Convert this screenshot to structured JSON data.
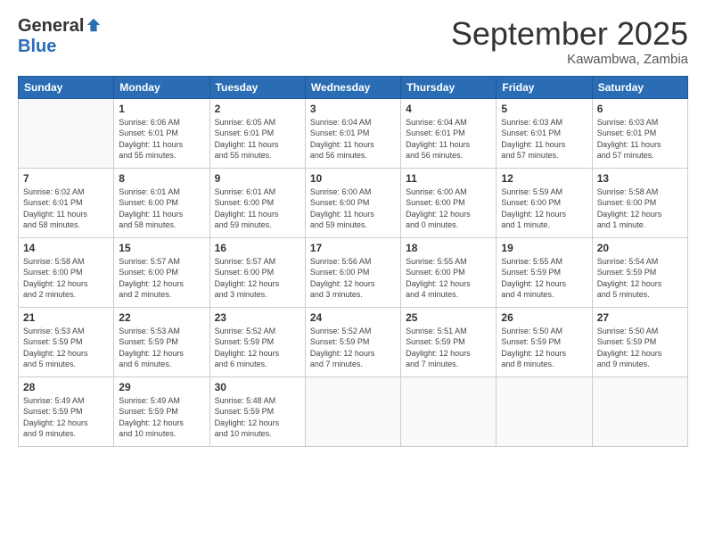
{
  "logo": {
    "general": "General",
    "blue": "Blue"
  },
  "title": "September 2025",
  "subtitle": "Kawambwa, Zambia",
  "weekdays": [
    "Sunday",
    "Monday",
    "Tuesday",
    "Wednesday",
    "Thursday",
    "Friday",
    "Saturday"
  ],
  "weeks": [
    [
      {
        "day": "",
        "info": ""
      },
      {
        "day": "1",
        "info": "Sunrise: 6:06 AM\nSunset: 6:01 PM\nDaylight: 11 hours\nand 55 minutes."
      },
      {
        "day": "2",
        "info": "Sunrise: 6:05 AM\nSunset: 6:01 PM\nDaylight: 11 hours\nand 55 minutes."
      },
      {
        "day": "3",
        "info": "Sunrise: 6:04 AM\nSunset: 6:01 PM\nDaylight: 11 hours\nand 56 minutes."
      },
      {
        "day": "4",
        "info": "Sunrise: 6:04 AM\nSunset: 6:01 PM\nDaylight: 11 hours\nand 56 minutes."
      },
      {
        "day": "5",
        "info": "Sunrise: 6:03 AM\nSunset: 6:01 PM\nDaylight: 11 hours\nand 57 minutes."
      },
      {
        "day": "6",
        "info": "Sunrise: 6:03 AM\nSunset: 6:01 PM\nDaylight: 11 hours\nand 57 minutes."
      }
    ],
    [
      {
        "day": "7",
        "info": "Sunrise: 6:02 AM\nSunset: 6:01 PM\nDaylight: 11 hours\nand 58 minutes."
      },
      {
        "day": "8",
        "info": "Sunrise: 6:01 AM\nSunset: 6:00 PM\nDaylight: 11 hours\nand 58 minutes."
      },
      {
        "day": "9",
        "info": "Sunrise: 6:01 AM\nSunset: 6:00 PM\nDaylight: 11 hours\nand 59 minutes."
      },
      {
        "day": "10",
        "info": "Sunrise: 6:00 AM\nSunset: 6:00 PM\nDaylight: 11 hours\nand 59 minutes."
      },
      {
        "day": "11",
        "info": "Sunrise: 6:00 AM\nSunset: 6:00 PM\nDaylight: 12 hours\nand 0 minutes."
      },
      {
        "day": "12",
        "info": "Sunrise: 5:59 AM\nSunset: 6:00 PM\nDaylight: 12 hours\nand 1 minute."
      },
      {
        "day": "13",
        "info": "Sunrise: 5:58 AM\nSunset: 6:00 PM\nDaylight: 12 hours\nand 1 minute."
      }
    ],
    [
      {
        "day": "14",
        "info": "Sunrise: 5:58 AM\nSunset: 6:00 PM\nDaylight: 12 hours\nand 2 minutes."
      },
      {
        "day": "15",
        "info": "Sunrise: 5:57 AM\nSunset: 6:00 PM\nDaylight: 12 hours\nand 2 minutes."
      },
      {
        "day": "16",
        "info": "Sunrise: 5:57 AM\nSunset: 6:00 PM\nDaylight: 12 hours\nand 3 minutes."
      },
      {
        "day": "17",
        "info": "Sunrise: 5:56 AM\nSunset: 6:00 PM\nDaylight: 12 hours\nand 3 minutes."
      },
      {
        "day": "18",
        "info": "Sunrise: 5:55 AM\nSunset: 6:00 PM\nDaylight: 12 hours\nand 4 minutes."
      },
      {
        "day": "19",
        "info": "Sunrise: 5:55 AM\nSunset: 5:59 PM\nDaylight: 12 hours\nand 4 minutes."
      },
      {
        "day": "20",
        "info": "Sunrise: 5:54 AM\nSunset: 5:59 PM\nDaylight: 12 hours\nand 5 minutes."
      }
    ],
    [
      {
        "day": "21",
        "info": "Sunrise: 5:53 AM\nSunset: 5:59 PM\nDaylight: 12 hours\nand 5 minutes."
      },
      {
        "day": "22",
        "info": "Sunrise: 5:53 AM\nSunset: 5:59 PM\nDaylight: 12 hours\nand 6 minutes."
      },
      {
        "day": "23",
        "info": "Sunrise: 5:52 AM\nSunset: 5:59 PM\nDaylight: 12 hours\nand 6 minutes."
      },
      {
        "day": "24",
        "info": "Sunrise: 5:52 AM\nSunset: 5:59 PM\nDaylight: 12 hours\nand 7 minutes."
      },
      {
        "day": "25",
        "info": "Sunrise: 5:51 AM\nSunset: 5:59 PM\nDaylight: 12 hours\nand 7 minutes."
      },
      {
        "day": "26",
        "info": "Sunrise: 5:50 AM\nSunset: 5:59 PM\nDaylight: 12 hours\nand 8 minutes."
      },
      {
        "day": "27",
        "info": "Sunrise: 5:50 AM\nSunset: 5:59 PM\nDaylight: 12 hours\nand 9 minutes."
      }
    ],
    [
      {
        "day": "28",
        "info": "Sunrise: 5:49 AM\nSunset: 5:59 PM\nDaylight: 12 hours\nand 9 minutes."
      },
      {
        "day": "29",
        "info": "Sunrise: 5:49 AM\nSunset: 5:59 PM\nDaylight: 12 hours\nand 10 minutes."
      },
      {
        "day": "30",
        "info": "Sunrise: 5:48 AM\nSunset: 5:59 PM\nDaylight: 12 hours\nand 10 minutes."
      },
      {
        "day": "",
        "info": ""
      },
      {
        "day": "",
        "info": ""
      },
      {
        "day": "",
        "info": ""
      },
      {
        "day": "",
        "info": ""
      }
    ]
  ]
}
